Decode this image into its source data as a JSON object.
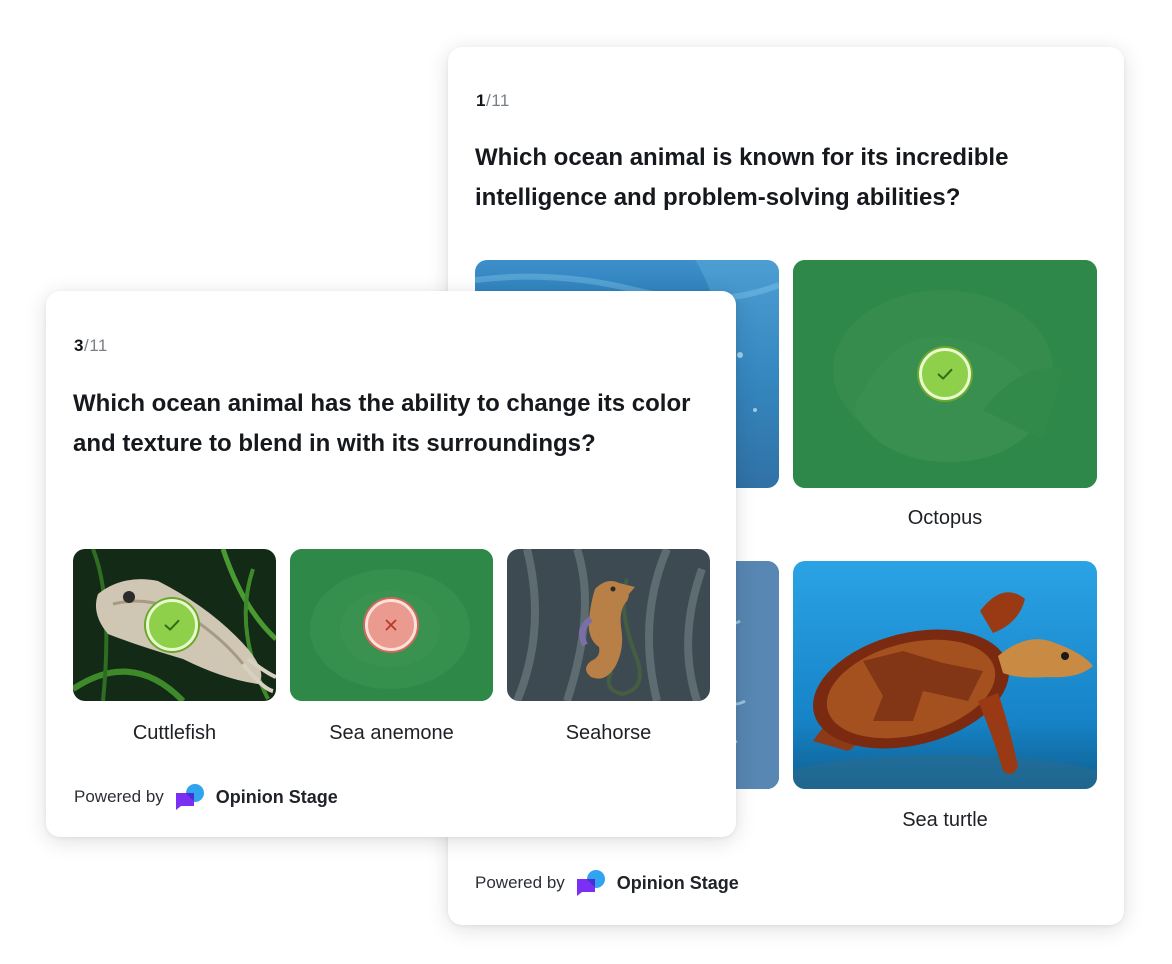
{
  "back_card": {
    "counter_current": "1",
    "counter_total": "/11",
    "question": "Which ocean animal is known for its incredible intelligence and problem-solving abilities?",
    "options": [
      {
        "label": "",
        "state": "none"
      },
      {
        "label": "Octopus",
        "state": "correct"
      },
      {
        "label": "",
        "state": "none"
      },
      {
        "label": "Sea turtle",
        "state": "none"
      }
    ],
    "powered_by": "Powered by",
    "brand": "Opinion Stage"
  },
  "front_card": {
    "counter_current": "3",
    "counter_total": "/11",
    "question": "Which ocean animal has the ability to change its color and texture to blend in with its surroundings?",
    "options": [
      {
        "label": "Cuttlefish",
        "state": "correct"
      },
      {
        "label": "Sea anemone",
        "state": "wrong"
      },
      {
        "label": "Seahorse",
        "state": "none"
      }
    ],
    "powered_by": "Powered by",
    "brand": "Opinion Stage"
  },
  "colors": {
    "correct_badge": "#8fd04a",
    "wrong_badge": "#ea9a8e",
    "selected_overlay": "#2e8c46",
    "brand_purple": "#7b2ff2",
    "brand_blue": "#2fa4ef"
  },
  "icons": [
    "check-icon",
    "close-icon",
    "opinion-stage-logo-icon"
  ]
}
